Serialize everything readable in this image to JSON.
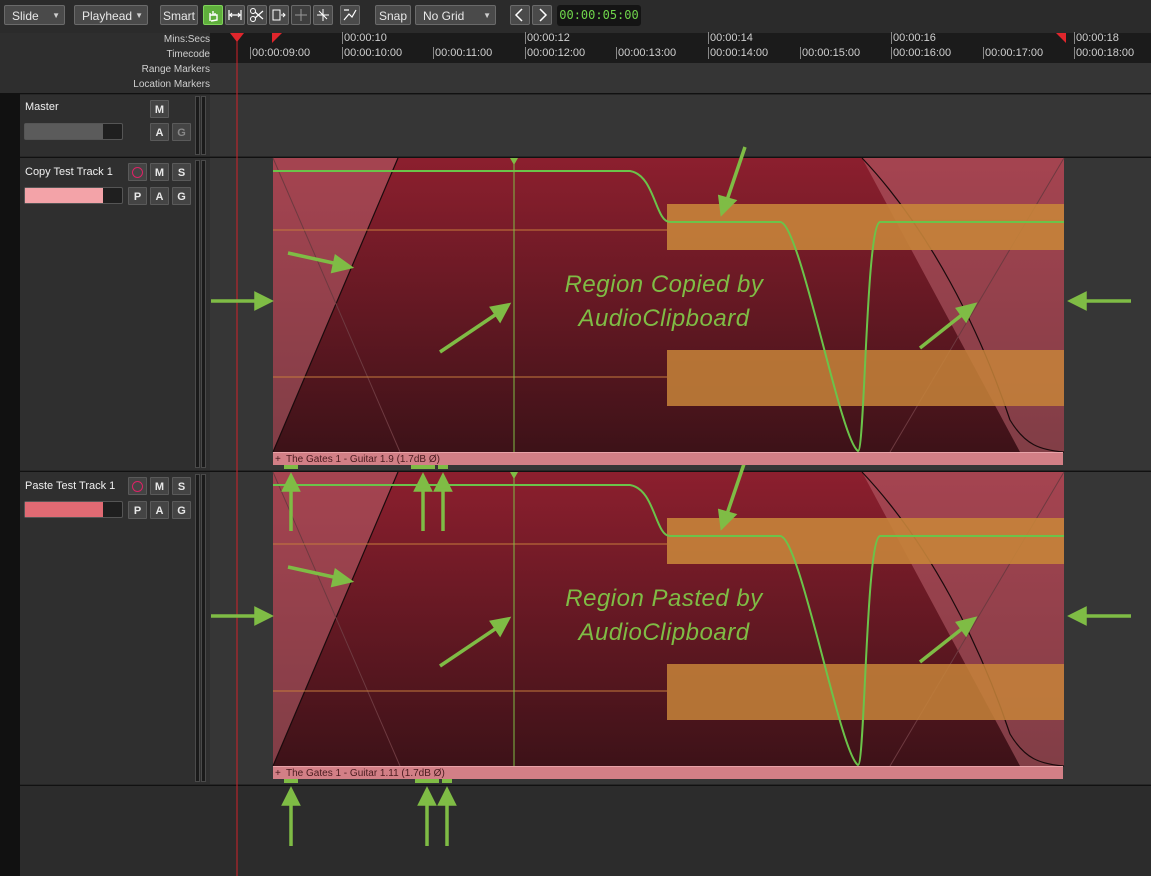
{
  "toolbar": {
    "edit_mode": "Slide",
    "edit_point": "Playhead",
    "smart_label": "Smart",
    "snap_label": "Snap",
    "grid_mode": "No Grid",
    "clock": "00:00:05:00",
    "accent": "#5fae3c"
  },
  "rulers": {
    "labels": [
      "Mins:Secs",
      "Timecode",
      "Range Markers",
      "Location Markers"
    ],
    "mins_secs": [
      "00:00:10",
      "00:00:12",
      "00:00:14",
      "00:00:16",
      "00:00:18"
    ],
    "timecode": [
      "00:00:09:00",
      "00:00:10:00",
      "00:00:11:00",
      "00:00:12:00",
      "00:00:13:00",
      "00:00:14:00",
      "00:00:15:00",
      "00:00:16:00",
      "00:00:17:00",
      "00:00:18:00"
    ]
  },
  "tracks": {
    "master": {
      "name": "Master",
      "m": "M",
      "a": "A",
      "g": "G"
    },
    "copy": {
      "name": "Copy Test Track 1",
      "m": "M",
      "s": "S",
      "p": "P",
      "a": "A",
      "g": "G",
      "color": "#f3a3a8"
    },
    "paste": {
      "name": "Paste Test Track 1",
      "m": "M",
      "s": "S",
      "p": "P",
      "a": "A",
      "g": "G",
      "color": "#e06a73"
    }
  },
  "regions": {
    "copy": {
      "name": "The Gates 1 - Guitar 1.9 (1.7dB Ø)",
      "caption_line1": "Region Copied by",
      "caption_line2": "AudioClipboard"
    },
    "paste": {
      "name": "The Gates 1 - Guitar 1.11 (1.7dB Ø)",
      "caption_line1": "Region Pasted by",
      "caption_line2": "AudioClipboard"
    }
  }
}
